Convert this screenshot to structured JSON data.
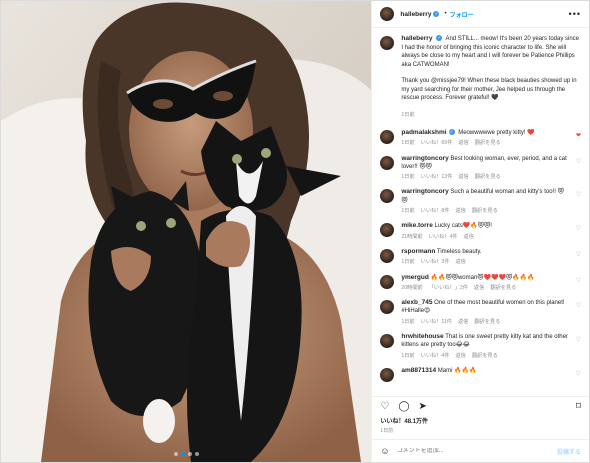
{
  "photo": {
    "description_icon": "photo-of-woman-with-cat-mask-and-two-kittens",
    "dots": 4,
    "active_dot": 2
  },
  "header": {
    "username": "halleberry",
    "verified_icon": "verified-badge-icon",
    "separator": "•",
    "follow_label": "フォロー",
    "more_icon": "•••"
  },
  "caption": {
    "username": "halleberry",
    "paragraph1": "And STILL... meow! It's been 20 years today since I had the honor of bringing this iconic character to life. She will always be close to my heart and I will forever be Patience Phillips aka CATWOMAN!",
    "paragraph2": "Thank you @missjee79! When these black beauties showed up in my yard searching for their mother, Jee helped us through the rescue process. Forever grateful! 🖤",
    "time": "1日前"
  },
  "comments": [
    {
      "username": "padmalakshmi",
      "verified": true,
      "text": "Meowwwwwe pretty kitty! ❤️",
      "time": "1日前",
      "likes": "いいね！69件",
      "reply": "返信",
      "translate": "翻訳を見る",
      "heart_red": true
    },
    {
      "username": "warringtoncory",
      "verified": false,
      "text": "Best looking woman, ever, period, and a cat lover!! 😻😻",
      "time": "1日前",
      "likes": "いいね！13件",
      "reply": "返信",
      "translate": "翻訳を見る",
      "heart_red": false
    },
    {
      "username": "warringtoncory",
      "verified": false,
      "text": "Such a beautiful woman and kitty's too!! 😻😻",
      "time": "1日前",
      "likes": "いいね！8件",
      "reply": "返信",
      "translate": "翻訳を見る",
      "heart_red": false
    },
    {
      "username": "mike.torre",
      "verified": false,
      "text": "Lucky cats❤️🔥😻😻!",
      "time": "21時間前",
      "likes": "いいね！4件",
      "reply": "返信",
      "translate": "",
      "heart_red": false
    },
    {
      "username": "rspormann",
      "verified": false,
      "text": "Timeless beauty.",
      "time": "1日前",
      "likes": "いいね！3件",
      "reply": "返信",
      "translate": "",
      "heart_red": false
    },
    {
      "username": "ymergud",
      "verified": false,
      "text": "🔥🔥😻😻woman😻❤️❤️❤️😻🔥🔥🔥",
      "time": "20時間前",
      "likes": "「いいね！」2件",
      "reply": "返信",
      "translate": "翻訳を見る",
      "heart_red": false
    },
    {
      "username": "alexb_745",
      "verified": false,
      "text": "One of thee most beautiful women on this planet! #HiHalle😍",
      "time": "1日前",
      "likes": "いいね！11件",
      "reply": "返信",
      "translate": "翻訳を見る",
      "heart_red": false
    },
    {
      "username": "hrwhitehouse",
      "verified": false,
      "text": "That is one sweet pretty kitty kat and the other kittens are pretty too😂😂",
      "time": "1日前",
      "likes": "いいね！4件",
      "reply": "返信",
      "translate": "翻訳を見る",
      "heart_red": false
    },
    {
      "username": "am8871314",
      "verified": false,
      "text": "Mami 🔥🔥🔥",
      "time": "",
      "likes": "",
      "reply": "",
      "translate": "",
      "heart_red": false
    }
  ],
  "actions": {
    "like_icon": "♡",
    "comment_icon": "◯",
    "share_icon": "➤",
    "bookmark_icon": "⌑"
  },
  "likes_text": "いいね！48.1万件",
  "posted_time": "1日前",
  "add_comment": {
    "emoji_icon": "☺",
    "placeholder": "コメントを追加...",
    "post_label": "投稿する"
  }
}
